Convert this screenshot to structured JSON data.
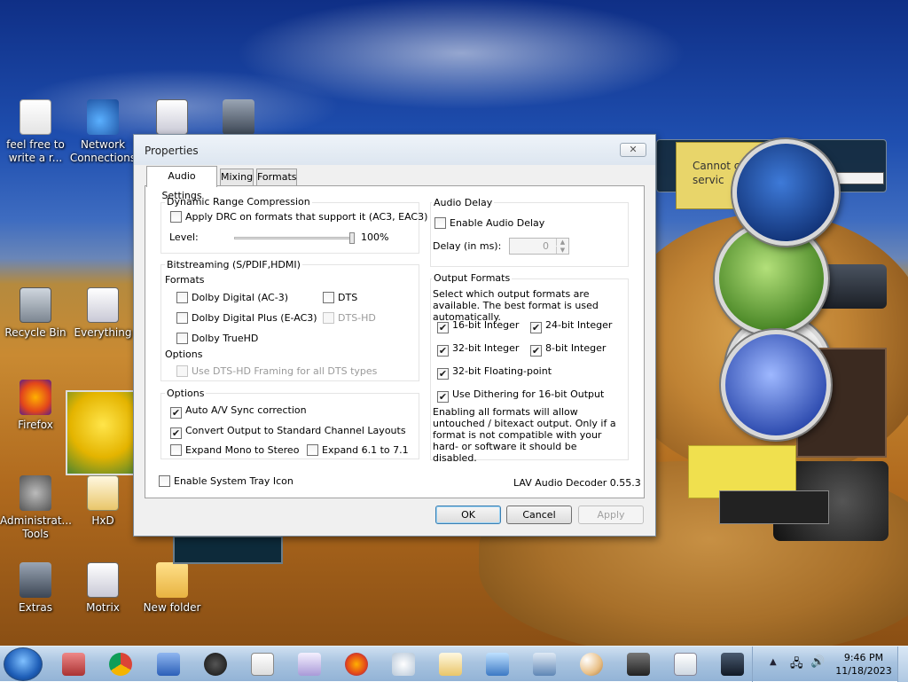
{
  "desktop": {
    "icons": [
      {
        "label": "feel free to write a r...",
        "icon": "text-document-icon"
      },
      {
        "label": "Network Connections",
        "icon": "network-connections-icon"
      },
      {
        "label": "Recycle Bin",
        "icon": "recycle-bin-icon"
      },
      {
        "label": "Everything",
        "icon": "everything-app-icon"
      },
      {
        "label": "Firefox",
        "icon": "firefox-icon"
      },
      {
        "label": "Administrat... Tools",
        "icon": "administrative-tools-icon"
      },
      {
        "label": "HxD",
        "icon": "hxd-icon"
      },
      {
        "label": "Extras",
        "icon": "extras-icon"
      },
      {
        "label": "Motrix",
        "icon": "motrix-icon"
      },
      {
        "label": "New folder",
        "icon": "folder-icon"
      }
    ],
    "gadget_notice": "Cannot c to servic"
  },
  "dialog": {
    "title": "Properties",
    "close": "✕",
    "tabs": [
      {
        "label": "Audio Settings",
        "active": true
      },
      {
        "label": "Mixing",
        "active": false
      },
      {
        "label": "Formats",
        "active": false
      }
    ],
    "drc": {
      "group_label": "Dynamic Range Compression",
      "apply_label": "Apply DRC on formats that support it (AC3, EAC3)",
      "apply_checked": false,
      "level_label": "Level:",
      "level_value": "100%",
      "level_fraction": 1.0
    },
    "bitstreaming": {
      "group_label": "Bitstreaming (S/PDIF,HDMI)",
      "formats_label": "Formats",
      "formats": [
        {
          "label": "Dolby Digital (AC-3)",
          "checked": false,
          "enabled": true
        },
        {
          "label": "DTS",
          "checked": false,
          "enabled": true
        },
        {
          "label": "Dolby Digital Plus (E-AC3)",
          "checked": false,
          "enabled": true
        },
        {
          "label": "DTS-HD",
          "checked": false,
          "enabled": false
        },
        {
          "label": "Dolby TrueHD",
          "checked": false,
          "enabled": true
        }
      ],
      "options_label": "Options",
      "dts_framing_label": "Use DTS-HD Framing for all DTS types",
      "dts_framing_enabled": false
    },
    "options": {
      "group_label": "Options",
      "items": [
        {
          "label": "Auto A/V Sync correction",
          "checked": true
        },
        {
          "label": "Convert Output to Standard Channel Layouts",
          "checked": true
        },
        {
          "label": "Expand Mono to Stereo",
          "checked": false
        },
        {
          "label": "Expand 6.1 to 7.1",
          "checked": false
        }
      ]
    },
    "audio_delay": {
      "group_label": "Audio Delay",
      "enable_label": "Enable Audio Delay",
      "enable_checked": false,
      "delay_label": "Delay (in ms):",
      "delay_value": "0"
    },
    "output_formats": {
      "group_label": "Output Formats",
      "description": "Select which output formats are available. The best format is used automatically.",
      "formats": [
        {
          "label": "16-bit Integer",
          "checked": true
        },
        {
          "label": "24-bit Integer",
          "checked": true
        },
        {
          "label": "32-bit Integer",
          "checked": true
        },
        {
          "label": "8-bit Integer",
          "checked": true
        },
        {
          "label": "32-bit Floating-point",
          "checked": true
        }
      ],
      "dithering_label": "Use Dithering for 16-bit Output",
      "dithering_checked": true,
      "note": "Enabling all formats will allow untouched / bitexact output. Only if a format is not compatible with your hard- or software it should be disabled."
    },
    "tray_icon_label": "Enable System Tray Icon",
    "tray_icon_checked": false,
    "version": "LAV Audio Decoder 0.55.3",
    "buttons": {
      "ok": "OK",
      "cancel": "Cancel",
      "apply": "Apply"
    }
  },
  "taskbar": {
    "pinned": [
      "start-orb-icon",
      "media-library-icon",
      "chrome-icon",
      "paint-icon",
      "ink-pot-icon",
      "solitaire-icon",
      "app-window-icon",
      "firefox-icon",
      "clipboard-icon",
      "hxd-icon",
      "remote-desktop-icon",
      "network-computer-icon",
      "paint-palette-icon",
      "photo-viewer-icon",
      "notepad-icon",
      "phone-icon"
    ],
    "clock_time": "9:46 PM",
    "clock_date": "11/18/2023",
    "tray_up_arrow": "▲"
  },
  "colors": {
    "dialog_bg": "#f0f0f0",
    "page_bg": "#ffffff",
    "taskbar_top": "#cfe0f1",
    "taskbar_bottom": "#92b3d6",
    "default_button_border": "#3c7fb1"
  }
}
